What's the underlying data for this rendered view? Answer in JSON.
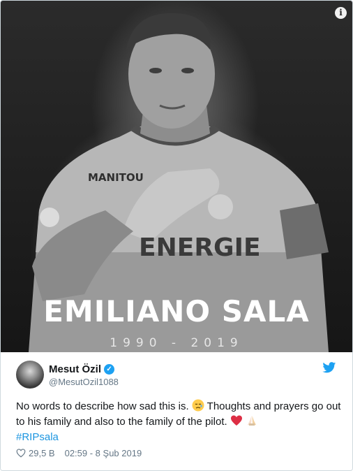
{
  "media": {
    "headline": "EMILIANO SALA",
    "years": "1990 - 2019",
    "info_icon": "i",
    "sponsor_left": "MANITOU",
    "sponsor_right": "ENERGIE"
  },
  "tweet": {
    "display_name": "Mesut Özil",
    "handle": "@MesutOzil1088",
    "text_part1": "No words to describe how sad this is. ",
    "text_part2": " Thoughts and prayers go out to his family and also to the family of the pilot. ",
    "hashtag": "#RIPsala",
    "likes": "29,5 B",
    "timestamp": "02:59 - 8 Şub 2019"
  },
  "colors": {
    "accent": "#1da1f2",
    "hashtag": "#1b95e0",
    "muted": "#657786",
    "text": "#14171a"
  },
  "icons": [
    "info-icon",
    "verified-badge-icon",
    "twitter-bird-icon",
    "sad-face-emoji",
    "red-heart-emoji",
    "praying-hands-emoji",
    "heart-icon"
  ]
}
